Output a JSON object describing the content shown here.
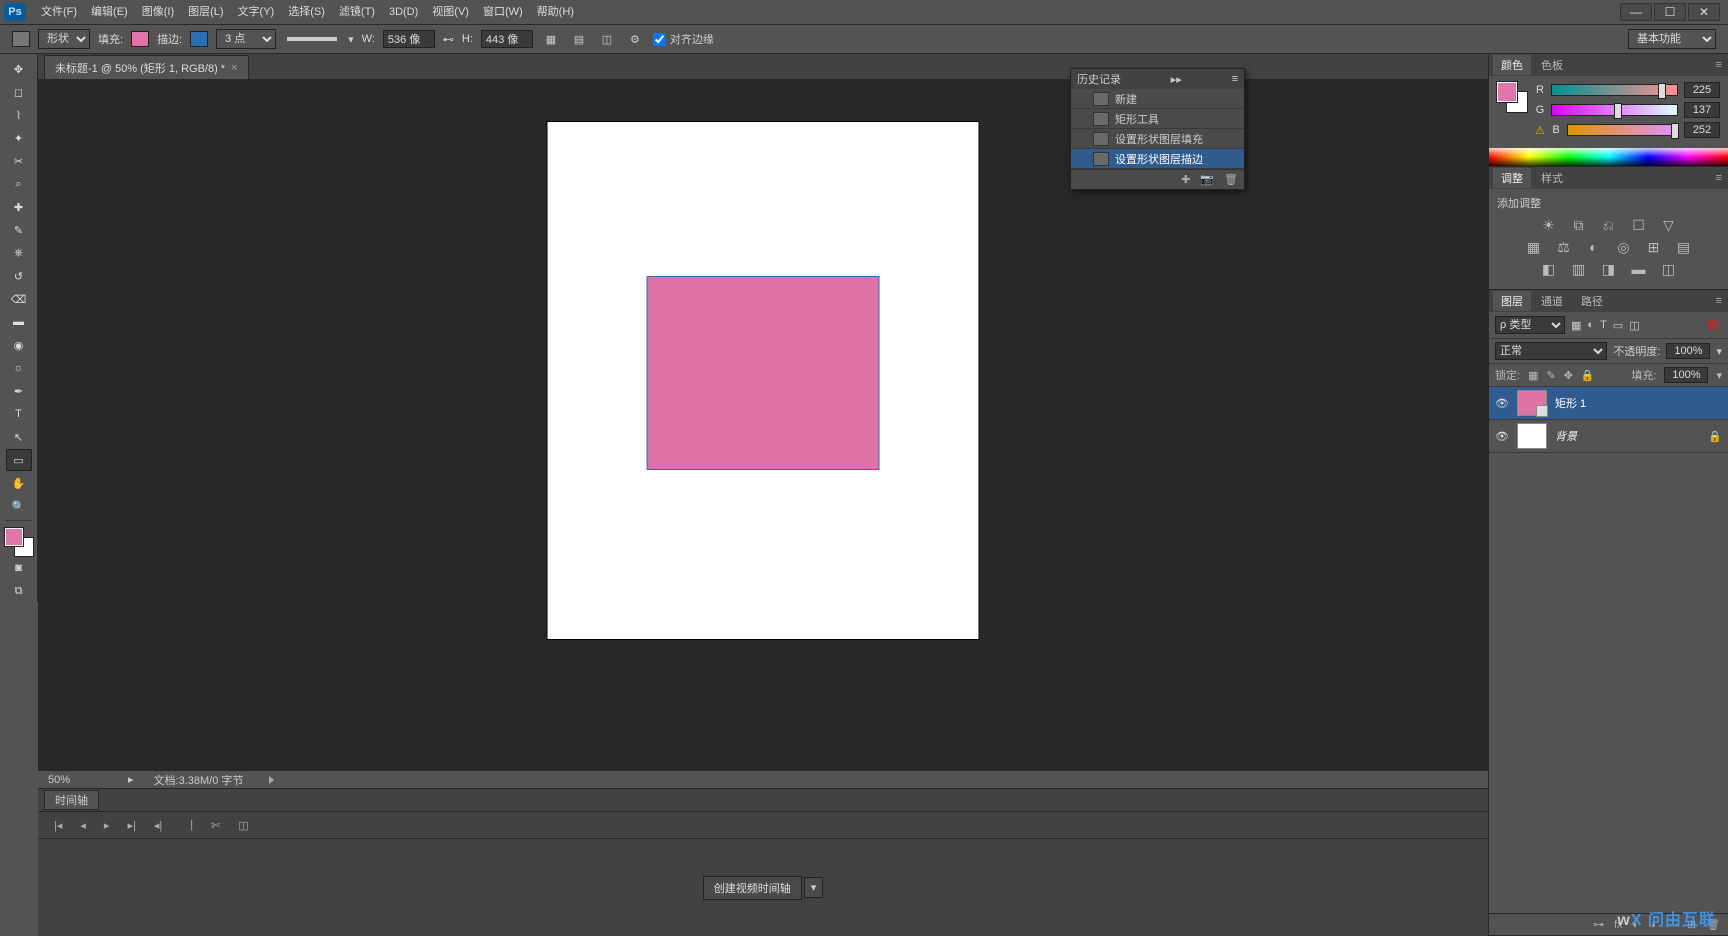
{
  "menu": {
    "logo": "Ps",
    "items": [
      "文件(F)",
      "编辑(E)",
      "图像(I)",
      "图层(L)",
      "文字(Y)",
      "选择(S)",
      "滤镜(T)",
      "3D(D)",
      "视图(V)",
      "窗口(W)",
      "帮助(H)"
    ]
  },
  "options": {
    "shape_mode": "形状",
    "fill_label": "填充:",
    "fill_color": "#e174a8",
    "stroke_label": "描边:",
    "stroke_color": "#2a6fb2",
    "stroke_weight": "3 点",
    "w_label": "W:",
    "w_value": "536 像",
    "h_label": "H:",
    "h_value": "443 像",
    "align_edges": "对齐边缘",
    "workspace": "基本功能"
  },
  "document": {
    "tab_title": "未标题-1 @ 50% (矩形 1, RGB/8) *",
    "shape_fill": "#e073a5",
    "shape_stroke": "#2a6fb2"
  },
  "status": {
    "zoom": "50%",
    "doc_info": "文档:3.38M/0 字节"
  },
  "timeline": {
    "tab": "时间轴",
    "create_button": "创建视频时间轴"
  },
  "history": {
    "title": "历史记录",
    "items": [
      "新建",
      "矩形工具",
      "设置形状图层填充",
      "设置形状图层描边"
    ],
    "selected": 3
  },
  "color_panel": {
    "tabs": [
      "颜色",
      "色板"
    ],
    "channels": [
      {
        "label": "R",
        "value": "225",
        "pos": 88
      },
      {
        "label": "G",
        "value": "137",
        "pos": 53
      },
      {
        "label": "B",
        "value": "252",
        "pos": 98
      }
    ]
  },
  "adjustments_panel": {
    "tabs": [
      "调整",
      "样式"
    ],
    "title": "添加调整"
  },
  "layers_panel": {
    "tabs": [
      "图层",
      "通道",
      "路径"
    ],
    "filter": "ρ 类型",
    "blend_mode": "正常",
    "opacity_label": "不透明度:",
    "opacity": "100%",
    "lock_label": "锁定:",
    "fill_label": "填充:",
    "fill": "100%",
    "layers": [
      {
        "name": "矩形 1",
        "kind": "shape",
        "selected": true,
        "locked": false
      },
      {
        "name": "背景",
        "kind": "bg",
        "selected": false,
        "locked": true,
        "italic": true
      }
    ]
  },
  "watermark": "问由互联"
}
